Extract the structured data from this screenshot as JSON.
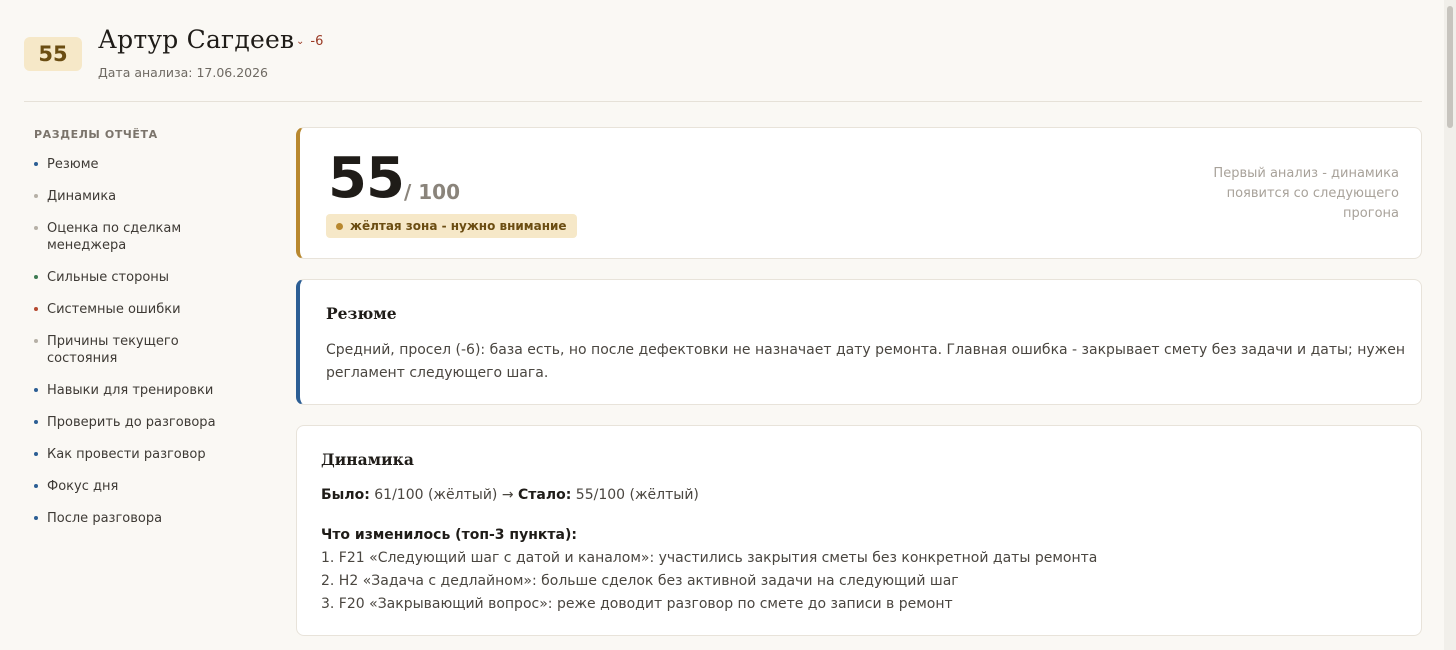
{
  "header": {
    "score": "55",
    "name": "Артур Сагдеев",
    "delta": "-6",
    "analysis_date": "Дата анализа: 17.06.2026"
  },
  "sidebar": {
    "title": "РАЗДЕЛЫ ОТЧЁТА",
    "items": [
      {
        "label": "Резюме",
        "color": "#2c5e94"
      },
      {
        "label": "Динамика",
        "color": "#b6b0a6"
      },
      {
        "label": "Оценка по сделкам менеджера",
        "color": "#b6b0a6"
      },
      {
        "label": "Сильные стороны",
        "color": "#3d7a52"
      },
      {
        "label": "Системные ошибки",
        "color": "#b5492f"
      },
      {
        "label": "Причины текущего состояния",
        "color": "#b6b0a6"
      },
      {
        "label": "Навыки для тренировки",
        "color": "#2c5e94"
      },
      {
        "label": "Проверить до разговора",
        "color": "#2c5e94"
      },
      {
        "label": "Как провести разговор",
        "color": "#2c5e94"
      },
      {
        "label": "Фокус дня",
        "color": "#2c5e94"
      },
      {
        "label": "После разговора",
        "color": "#2c5e94"
      }
    ]
  },
  "score_card": {
    "score": "55",
    "max": "/ 100",
    "zone": "жёлтая зона - нужно внимание",
    "note": "Первый анализ - динамика появится со следующего прогона"
  },
  "resume": {
    "title": "Резюме",
    "text": "Средний, просел (-6): база есть, но после дефектовки не назначает дату ремонта. Главная ошибка - закрывает смету без задачи и даты; нужен регламент следующего шага."
  },
  "dynamics": {
    "title": "Динамика",
    "was_label": "Было:",
    "was_value": "61/100 (жёлтый)",
    "arrow": "→",
    "now_label": "Стало:",
    "now_value": "55/100 (жёлтый)",
    "changes_title": "Что изменилось (топ-3 пункта):",
    "changes": [
      "1. F21 «Следующий шаг с датой и каналом»: участились закрытия сметы без конкретной даты ремонта",
      "2. H2 «Задача с дедлайном»: больше сделок без активной задачи на следующий шаг",
      "3. F20 «Закрывающий вопрос»: реже доводит разговор по смете до записи в ремонт"
    ]
  },
  "colors": {
    "accent_yellow": "#b8882f",
    "accent_blue": "#2c5e94",
    "badge_bg": "#f6e8c8"
  }
}
